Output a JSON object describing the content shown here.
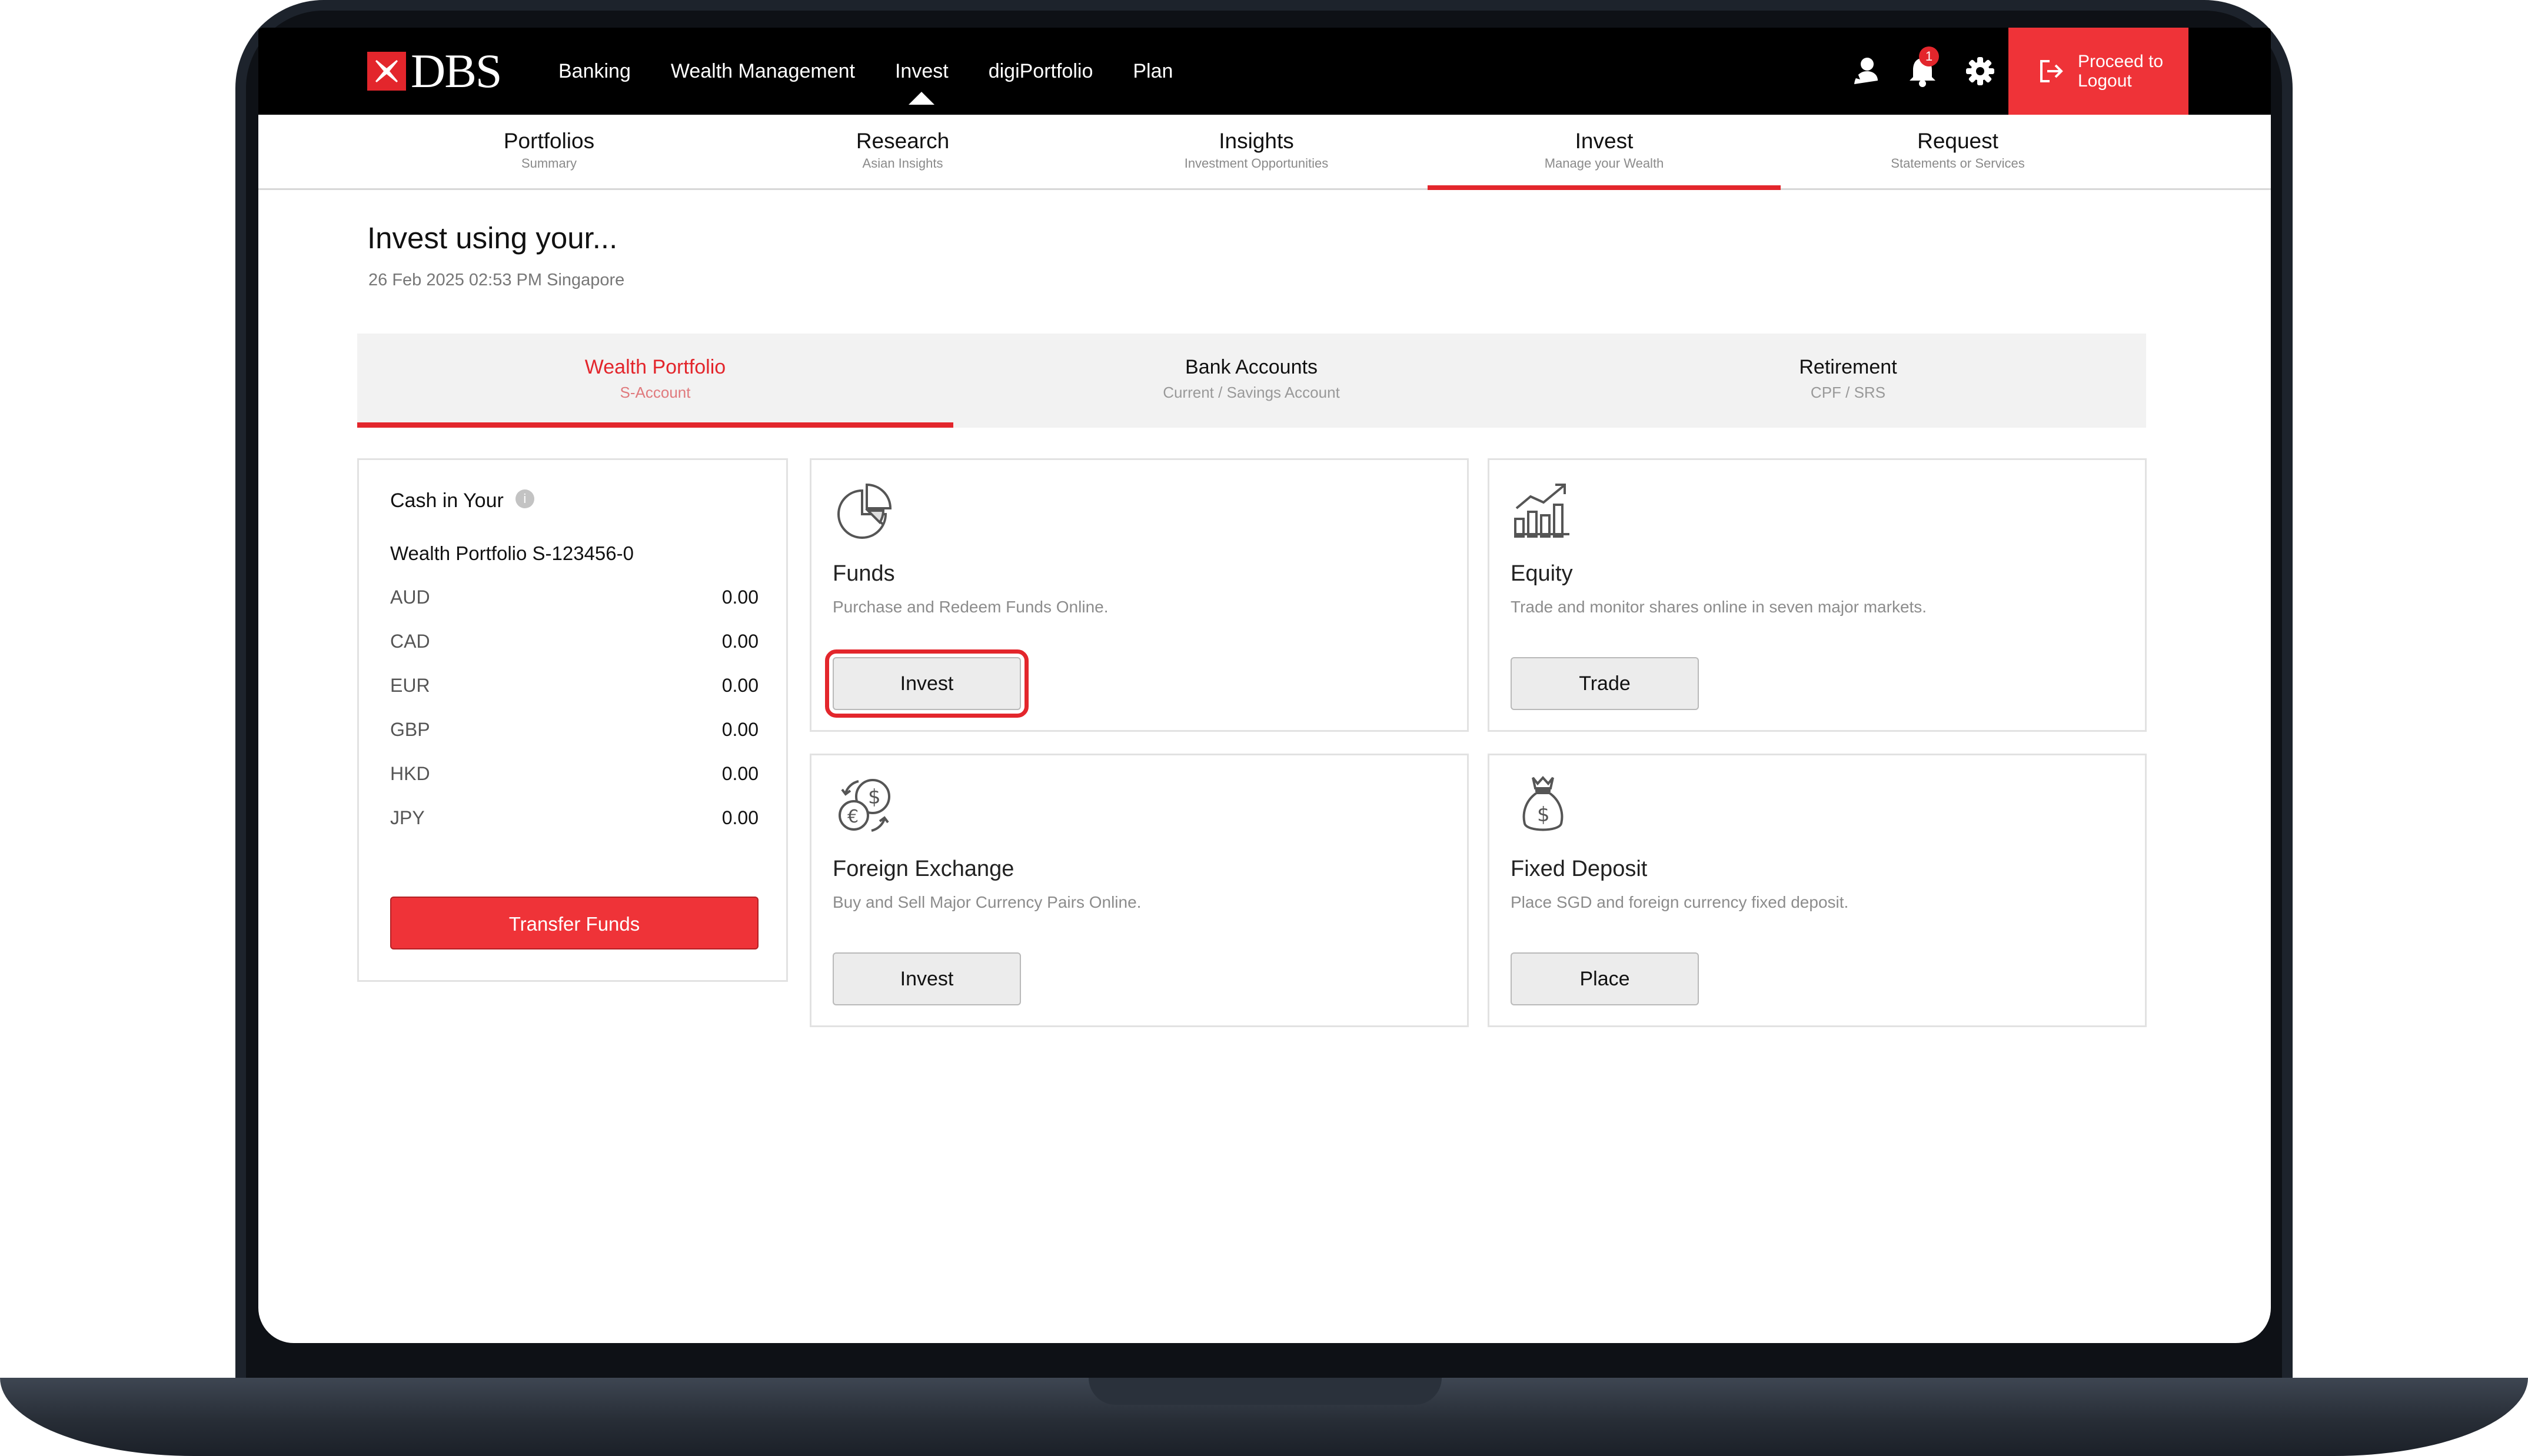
{
  "brand": {
    "logo_text": "DBS",
    "accent": "#e3262c"
  },
  "topnav": {
    "items": [
      "Banking",
      "Wealth Management",
      "Invest",
      "digiPortfolio",
      "Plan"
    ],
    "active_index": 2,
    "notification_count": "1",
    "logout_label": "Proceed to Logout"
  },
  "subnav": [
    {
      "title": "Portfolios",
      "sub": "Summary"
    },
    {
      "title": "Research",
      "sub": "Asian Insights"
    },
    {
      "title": "Insights",
      "sub": "Investment Opportunities"
    },
    {
      "title": "Invest",
      "sub": "Manage your Wealth"
    },
    {
      "title": "Request",
      "sub": "Statements or Services"
    }
  ],
  "page": {
    "title": "Invest using your...",
    "date": "26 Feb 2025 02:53 PM Singapore"
  },
  "account_tabs": [
    {
      "title": "Wealth Portfolio",
      "sub": "S-Account"
    },
    {
      "title": "Bank Accounts",
      "sub": "Current / Savings Account"
    },
    {
      "title": "Retirement",
      "sub": "CPF / SRS"
    }
  ],
  "cash": {
    "title": "Cash in Your",
    "account": "Wealth Portfolio S-123456-0",
    "rows": [
      {
        "code": "AUD",
        "amount": "0.00"
      },
      {
        "code": "CAD",
        "amount": "0.00"
      },
      {
        "code": "EUR",
        "amount": "0.00"
      },
      {
        "code": "GBP",
        "amount": "0.00"
      },
      {
        "code": "HKD",
        "amount": "0.00"
      },
      {
        "code": "JPY",
        "amount": "0.00"
      }
    ],
    "transfer_label": "Transfer Funds"
  },
  "products": [
    {
      "name": "Funds",
      "desc": "Purchase and Redeem Funds Online.",
      "button": "Invest",
      "icon": "pie-chart-icon"
    },
    {
      "name": "Equity",
      "desc": "Trade and monitor shares online in seven major markets.",
      "button": "Trade",
      "icon": "bar-chart-icon"
    },
    {
      "name": "Foreign Exchange",
      "desc": "Buy and Sell Major Currency Pairs Online.",
      "button": "Invest",
      "icon": "currency-exchange-icon"
    },
    {
      "name": "Fixed Deposit",
      "desc": "Place SGD and foreign currency fixed deposit.",
      "button": "Place",
      "icon": "money-bag-icon"
    }
  ]
}
